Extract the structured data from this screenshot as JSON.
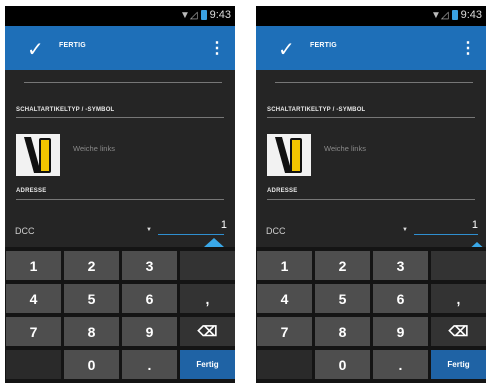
{
  "screens": [
    {
      "status_time": "9:43",
      "done_label": "FERTIG",
      "overflow_glyph": "⋮",
      "check_glyph": "✓",
      "type_section": "SCHALTARTIKELTYP / -SYMBOL",
      "type_name": "Weiche links",
      "address_section": "ADRESSE",
      "protocol": "DCC",
      "address": "1",
      "keys": [
        "1",
        "2",
        "3",
        "",
        "4",
        "5",
        "6",
        ",",
        "7",
        "8",
        "9",
        "⌫",
        "",
        "0",
        ".",
        "Fertig"
      ]
    },
    {
      "status_time": "9:43",
      "done_label": "FERTIG",
      "overflow_glyph": "⋮",
      "check_glyph": "✓",
      "type_section": "SCHALTARTIKELTYP / -SYMBOL",
      "type_name": "Weiche links",
      "address_section": "ADRESSE",
      "protocol": "DCC",
      "address": "1",
      "keys": [
        "1",
        "2",
        "3",
        "",
        "4",
        "5",
        "6",
        ",",
        "7",
        "8",
        "9",
        "⌫",
        "",
        "0",
        ".",
        "Fertig"
      ]
    }
  ],
  "colors": {
    "accent": "#1e6fb8",
    "background": "#252525",
    "key": "#4e4e4e",
    "done_key": "#1f63a5",
    "icon_yellow": "#f2c500"
  }
}
